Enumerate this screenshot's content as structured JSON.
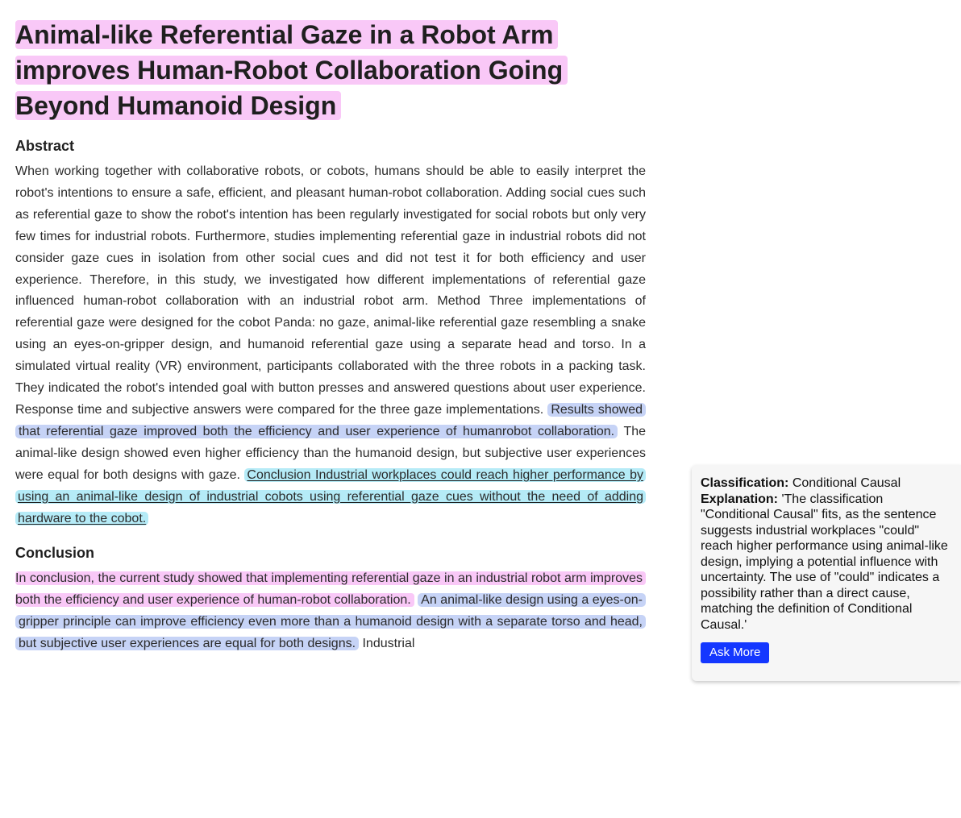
{
  "article": {
    "title": "Animal-like Referential Gaze in a Robot Arm improves Human-Robot Collaboration Going Beyond Humanoid Design",
    "abstract_heading": "Abstract",
    "abstract": {
      "plain": "When working together with collaborative robots, or cobots, humans should be able to easily interpret the robot's intentions to ensure a safe, efficient, and pleasant human-robot collaboration. Adding social cues such as referential gaze to show the robot's intention has been regularly investigated for social robots but only very few times for industrial robots. Furthermore, studies implementing referential gaze in industrial robots did not consider gaze cues in isolation from other social cues and did not test it for both efficiency and user experience. Therefore, in this study, we investigated how different implementations of referential gaze influenced human-robot collaboration with an industrial robot arm. Method Three implementations of referential gaze were designed for the cobot Panda: no gaze, animal-like referential gaze resembling a snake using an eyes-on-gripper design, and humanoid referential gaze using a separate head and torso. In a simulated virtual reality (VR) environment, participants collaborated with the three robots in a packing task. They indicated the robot's intended goal with button presses and answered questions about user experience. Response time and subjective answers were compared for the three gaze implementations.",
      "highlight_results": "Results showed that referential gaze improved both the efficiency and user experience of humanrobot collaboration.",
      "plain_2": "The animal-like design showed even higher efficiency than the humanoid design, but subjective user experiences were equal for both designs with gaze.",
      "highlight_conclusion": "Conclusion Industrial workplaces could reach higher performance by using an animal-like design of industrial cobots using referential gaze cues without the need of adding hardware to the cobot."
    },
    "conclusion_heading": "Conclusion",
    "conclusion": {
      "highlight_1": "In conclusion, the current study showed that implementing referential gaze in an industrial robot arm improves both the efficiency and user experience of human-robot collaboration.",
      "highlight_2": "An animal-like design using a eyes-on-gripper principle can improve efficiency even more than a humanoid design with a separate torso and head, but subjective user experiences are equal for both designs.",
      "plain": "Industrial"
    }
  },
  "sidebar": {
    "classification_label": "Classification:",
    "classification_value": "Conditional Causal",
    "explanation_label": "Explanation:",
    "explanation_value": "'The classification \"Conditional Causal\" fits, as the sentence suggests industrial workplaces \"could\" reach higher performance using animal-like design, implying a potential influence with uncertainty. The use of \"could\" indicates a possibility rather than a direct cause, matching the definition of Conditional Causal.'",
    "ask_more_label": "Ask More"
  },
  "colors": {
    "highlight_pink": "#f9c8f7",
    "highlight_blue": "#c6d3f6",
    "highlight_cyan": "#b5ebf7",
    "button_blue": "#1437ff"
  }
}
